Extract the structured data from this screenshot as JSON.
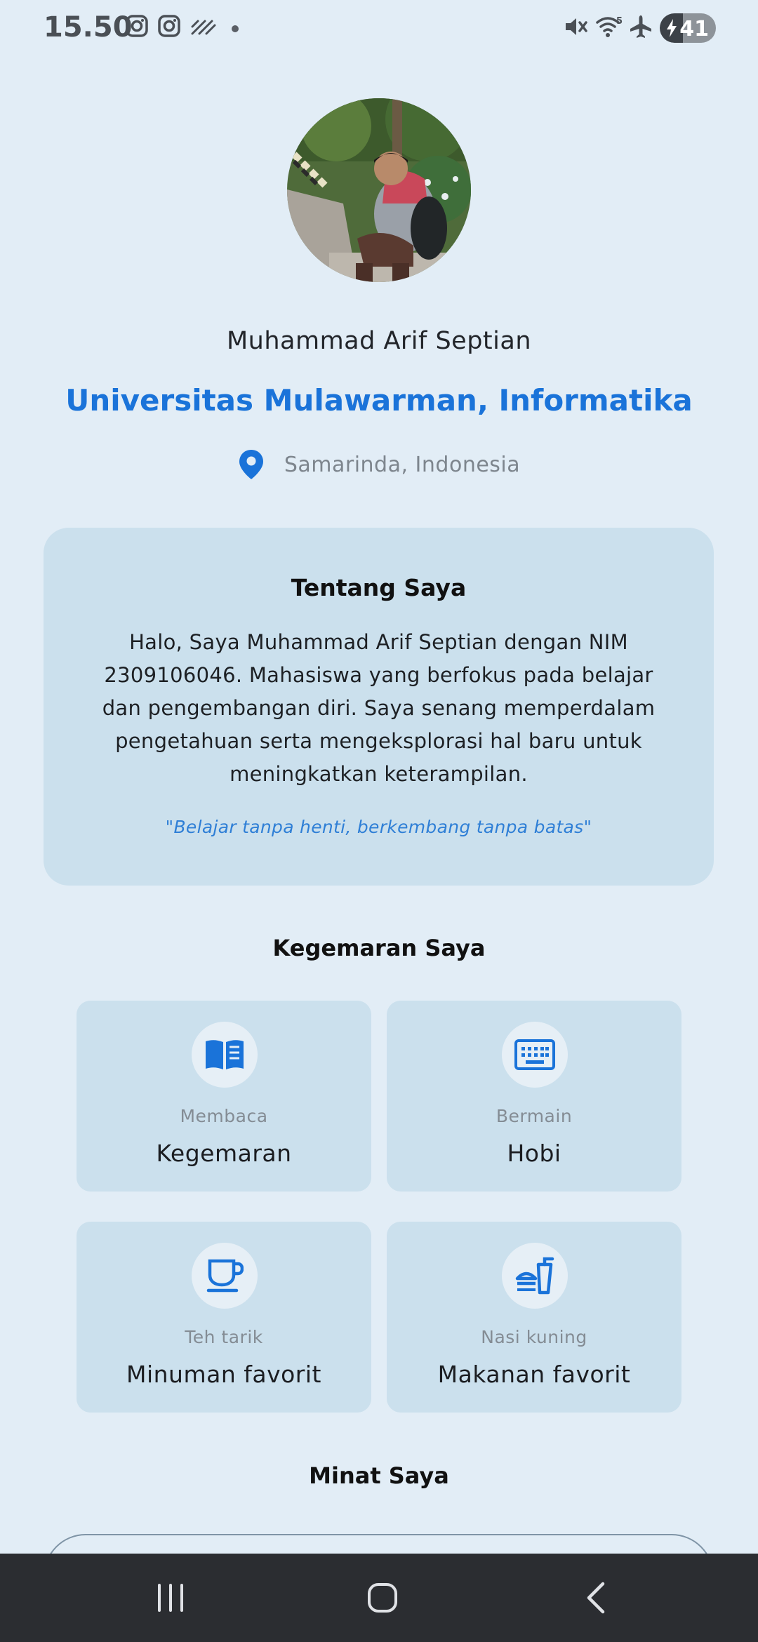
{
  "status_bar": {
    "time": "15.50",
    "battery_level": "41",
    "battery_fraction": 0.41,
    "icons": [
      "instagram-icon",
      "instagram-icon",
      "signal-pattern-icon",
      "notification-dot-icon",
      "mute-icon",
      "wifi-icon",
      "airplane-icon",
      "battery-charging-icon"
    ]
  },
  "profile": {
    "name": "Muhammad Arif Septian",
    "university": "Universitas Mulawarman, Informatika",
    "location": "Samarinda, Indonesia",
    "location_icon": "location-pin-icon"
  },
  "about": {
    "title": "Tentang Saya",
    "text": "Halo, Saya Muhammad Arif Septian dengan NIM 2309106046. Mahasiswa yang berfokus pada belajar dan pengembangan diri. Saya senang memperdalam pengetahuan serta mengeksplorasi hal baru untuk meningkatkan keterampilan.",
    "quote": "\"Belajar tanpa henti, berkembang tanpa batas\""
  },
  "hobbies": {
    "title": "Kegemaran Saya",
    "items": [
      {
        "icon": "book-icon",
        "value": "Membaca",
        "label": "Kegemaran"
      },
      {
        "icon": "keyboard-icon",
        "value": "Bermain",
        "label": "Hobi"
      },
      {
        "icon": "cup-icon",
        "value": "Teh tarik",
        "label": "Minuman favorit"
      },
      {
        "icon": "food-icon",
        "value": "Nasi kuning",
        "label": "Makanan favorit"
      }
    ]
  },
  "interests": {
    "title": "Minat Saya"
  },
  "nav_bar": {
    "icons": [
      "recent-apps-icon",
      "home-icon",
      "back-icon"
    ]
  },
  "colors": {
    "background": "#e2edf6",
    "card": "#cbe0ed",
    "accent": "#1a73d9",
    "nav": "#2b2d31"
  }
}
